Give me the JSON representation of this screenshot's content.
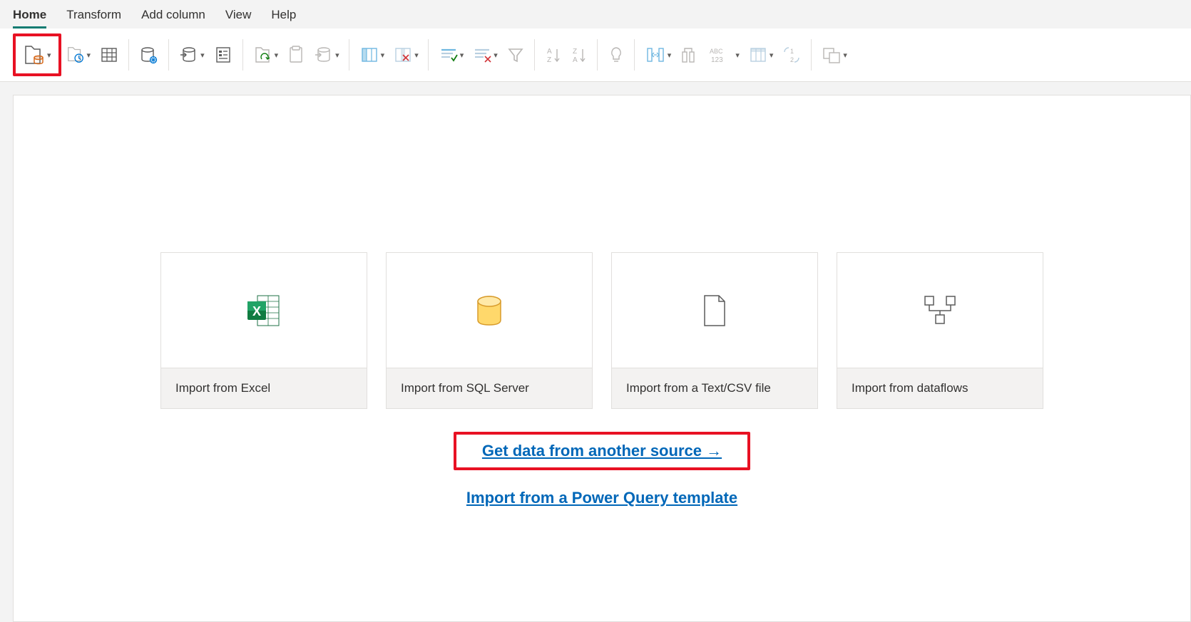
{
  "tabs": {
    "home": "Home",
    "transform": "Transform",
    "addColumn": "Add column",
    "view": "View",
    "help": "Help"
  },
  "cards": {
    "excel": "Import from Excel",
    "sql": "Import from SQL Server",
    "csv": "Import from a Text/CSV file",
    "dataflows": "Import from dataflows"
  },
  "links": {
    "another": "Get data from another source →",
    "pq_template": "Import from a Power Query template"
  }
}
